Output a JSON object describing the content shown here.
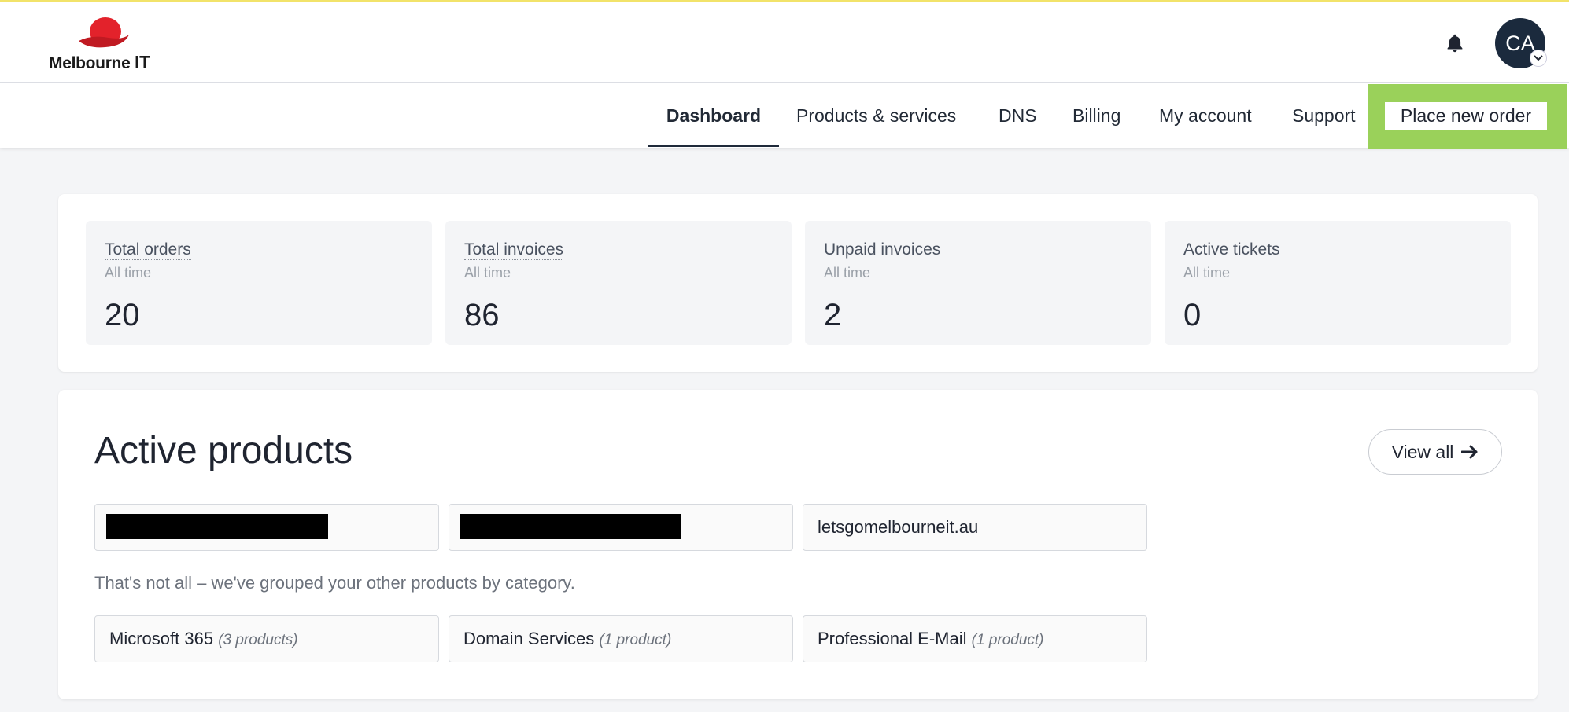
{
  "header": {
    "logo_text": "Melbourne",
    "logo_text_bold": "IT",
    "avatar_initials": "CA"
  },
  "nav": {
    "items": [
      "Dashboard",
      "Products & services",
      "DNS",
      "Billing",
      "My account",
      "Support"
    ],
    "active": "Dashboard",
    "place_order_label": "Place new order"
  },
  "stats": [
    {
      "label": "Total orders",
      "sub": "All time",
      "value": "20"
    },
    {
      "label": "Total invoices",
      "sub": "All time",
      "value": "86"
    },
    {
      "label": "Unpaid invoices",
      "sub": "All time",
      "value": "2"
    },
    {
      "label": "Active tickets",
      "sub": "All time",
      "value": "0"
    }
  ],
  "products": {
    "title": "Active products",
    "view_all_label": "View all",
    "items": [
      {
        "label": "",
        "redacted": true
      },
      {
        "label": "",
        "redacted": true
      },
      {
        "label": "letsgomelbourneit.au",
        "redacted": false
      }
    ],
    "note": "That's not all – we've grouped your other products by category.",
    "categories": [
      {
        "name": "Microsoft 365",
        "count": "(3 products)"
      },
      {
        "name": "Domain Services",
        "count": "(1 product)"
      },
      {
        "name": "Professional E-Mail",
        "count": "(1 product)"
      }
    ]
  },
  "colors": {
    "brand_red": "#e3222b",
    "highlight_green": "#9ad15a",
    "avatar_bg": "#1b2a3d"
  }
}
